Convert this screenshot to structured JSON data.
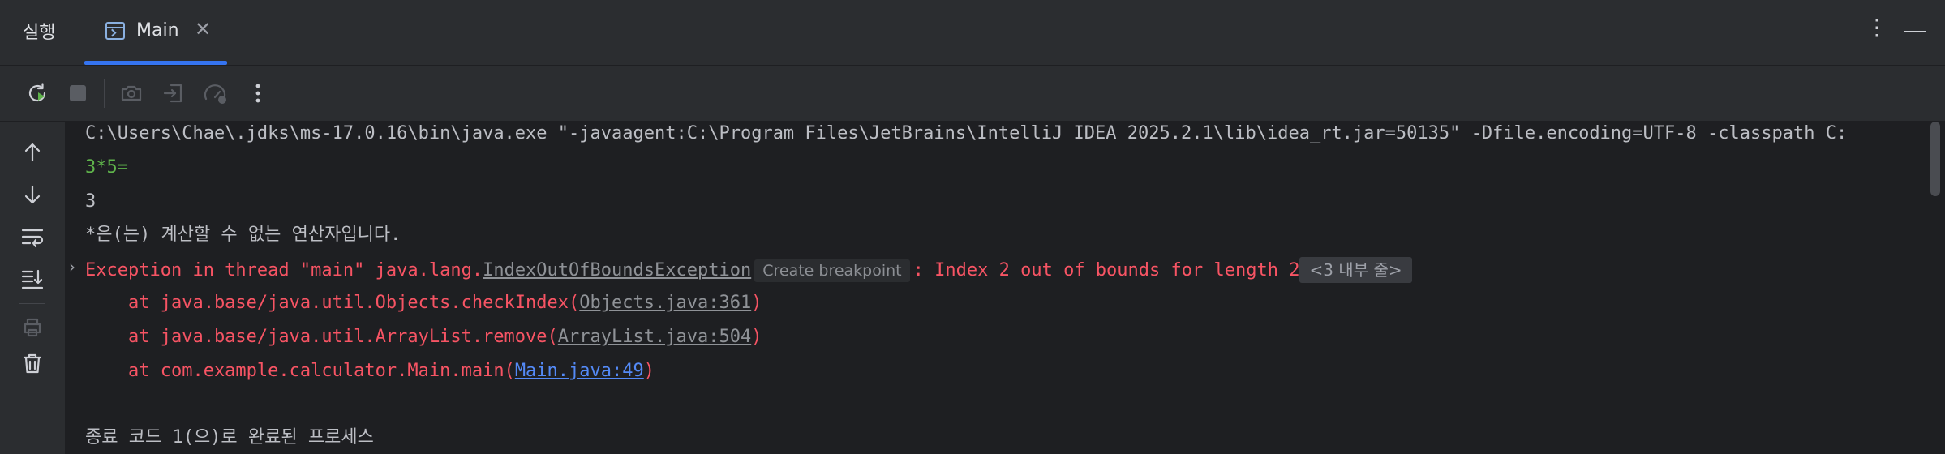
{
  "tabbar": {
    "run_label": "실행",
    "tab": {
      "label": "Main",
      "close": "✕"
    },
    "more": "⋮"
  },
  "console": {
    "command": "C:\\Users\\Chae\\.jdks\\ms-17.0.16\\bin\\java.exe \"-javaagent:C:\\Program Files\\JetBrains\\IntelliJ IDEA 2025.2.1\\lib\\idea_rt.jar=50135\" -Dfile.encoding=UTF-8 -classpath C:",
    "input_echo": "3*5=",
    "output_line": "3",
    "message_line": "*은(는) 계산할 수 없는 연산자입니다.",
    "exception": {
      "prefix": "Exception in thread \"main\" java.lang.",
      "class_link": "IndexOutOfBoundsException",
      "hint": "Create breakpoint",
      "message": ": Index 2 out of bounds for length 2",
      "fold": "<3 내부 줄>"
    },
    "stack": [
      {
        "prefix": "    at java.base/java.util.Objects.checkIndex(",
        "link": "Objects.java:361",
        "suffix": ")"
      },
      {
        "prefix": "    at java.base/java.util.ArrayList.remove(",
        "link": "ArrayList.java:504",
        "suffix": ")"
      },
      {
        "prefix": "    at com.example.calculator.Main.main(",
        "link": "Main.java:49",
        "suffix": ")"
      }
    ],
    "exit_line": "종료 코드 1(으)로 완료된 프로세스"
  },
  "colors": {
    "accent": "#3574f0",
    "error": "#f75464",
    "input": "#5fb34b",
    "link": "#548af7"
  },
  "icons": {
    "toolbar": [
      "rerun-icon",
      "stop-icon",
      "screenshot-icon",
      "exit-icon",
      "profiler-icon",
      "more-icon"
    ],
    "sidebar": [
      "arrow-up-icon",
      "arrow-down-icon",
      "soft-wrap-icon",
      "scroll-to-end-icon",
      "print-icon",
      "trash-icon"
    ]
  }
}
